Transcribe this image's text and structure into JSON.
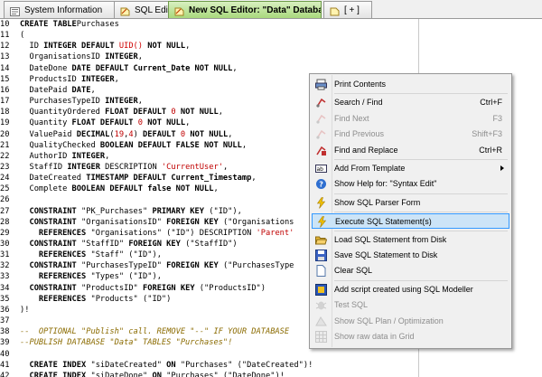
{
  "tabs": [
    {
      "label": "System Information",
      "icon": "info-icon"
    },
    {
      "label": "SQL Editor",
      "icon": "sql-editor-icon"
    },
    {
      "label": "New SQL Editor: \"Data\" Database",
      "icon": "sql-editor-icon"
    },
    {
      "label": "[ + ]",
      "icon": "new-tab-icon"
    }
  ],
  "code_lines": [
    {
      "n": "10",
      "segs": [
        [
          "kw",
          "CREATE TABLE"
        ],
        [
          "",
          "Purchases"
        ]
      ]
    },
    {
      "n": "11",
      "segs": [
        [
          "",
          "("
        ]
      ]
    },
    {
      "n": "12",
      "segs": [
        [
          "",
          "  ID "
        ],
        [
          "kw",
          "INTEGER DEFAULT"
        ],
        [
          "fn",
          " UID()"
        ],
        [
          "kw",
          " NOT NULL"
        ],
        [
          "",
          ","
        ]
      ]
    },
    {
      "n": "13",
      "segs": [
        [
          "",
          "  OrganisationsID "
        ],
        [
          "kw",
          "INTEGER"
        ],
        [
          "",
          ","
        ]
      ]
    },
    {
      "n": "14",
      "segs": [
        [
          "",
          "  DateDone "
        ],
        [
          "kw",
          "DATE DEFAULT"
        ],
        [
          "",
          " "
        ],
        [
          "kw",
          "Current_Date NOT NULL"
        ],
        [
          "",
          ","
        ]
      ]
    },
    {
      "n": "15",
      "segs": [
        [
          "",
          "  ProductsID "
        ],
        [
          "kw",
          "INTEGER"
        ],
        [
          "",
          ","
        ]
      ]
    },
    {
      "n": "16",
      "segs": [
        [
          "",
          "  DatePaid "
        ],
        [
          "kw",
          "DATE"
        ],
        [
          "",
          ","
        ]
      ]
    },
    {
      "n": "17",
      "segs": [
        [
          "",
          "  PurchasesTypeID "
        ],
        [
          "kw",
          "INTEGER"
        ],
        [
          "",
          ","
        ]
      ]
    },
    {
      "n": "18",
      "segs": [
        [
          "",
          "  QuantityOrdered "
        ],
        [
          "kw",
          "FLOAT DEFAULT"
        ],
        [
          "num",
          " 0"
        ],
        [
          "kw",
          " NOT NULL"
        ],
        [
          "",
          ","
        ]
      ]
    },
    {
      "n": "19",
      "segs": [
        [
          "",
          "  Quantity "
        ],
        [
          "kw",
          "FLOAT DEFAULT"
        ],
        [
          "num",
          " 0"
        ],
        [
          "kw",
          " NOT NULL"
        ],
        [
          "",
          ","
        ]
      ]
    },
    {
      "n": "20",
      "segs": [
        [
          "",
          "  ValuePaid "
        ],
        [
          "kw",
          "DECIMAL"
        ],
        [
          "",
          "("
        ],
        [
          "num",
          "19"
        ],
        [
          "",
          ","
        ],
        [
          "num",
          "4"
        ],
        [
          "",
          ") "
        ],
        [
          "kw",
          "DEFAULT"
        ],
        [
          "num",
          " 0"
        ],
        [
          "kw",
          " NOT NULL"
        ],
        [
          "",
          ","
        ]
      ]
    },
    {
      "n": "21",
      "segs": [
        [
          "",
          "  QualityChecked "
        ],
        [
          "kw",
          "BOOLEAN DEFAULT FALSE NOT NULL"
        ],
        [
          "",
          ","
        ]
      ]
    },
    {
      "n": "22",
      "segs": [
        [
          "",
          "  AuthorID "
        ],
        [
          "kw",
          "INTEGER"
        ],
        [
          "",
          ","
        ]
      ]
    },
    {
      "n": "23",
      "segs": [
        [
          "",
          "  StaffID "
        ],
        [
          "kw",
          "INTEGER"
        ],
        [
          "",
          " DESCRIPTION "
        ],
        [
          "str",
          "'CurrentUser'"
        ],
        [
          "",
          ","
        ]
      ]
    },
    {
      "n": "24",
      "segs": [
        [
          "",
          "  DateCreated "
        ],
        [
          "kw",
          "TIMESTAMP DEFAULT"
        ],
        [
          "",
          " "
        ],
        [
          "kw",
          "Current_Timestamp"
        ],
        [
          "",
          ","
        ]
      ]
    },
    {
      "n": "25",
      "segs": [
        [
          "",
          "  Complete "
        ],
        [
          "kw",
          "BOOLEAN DEFAULT"
        ],
        [
          "",
          " "
        ],
        [
          "kw",
          "false NOT NULL"
        ],
        [
          "",
          ","
        ]
      ]
    },
    {
      "n": "26",
      "segs": []
    },
    {
      "n": "27",
      "segs": [
        [
          "",
          "  "
        ],
        [
          "kw",
          "CONSTRAINT"
        ],
        [
          "",
          " \"PK_Purchases\" "
        ],
        [
          "kw",
          "PRIMARY KEY"
        ],
        [
          "",
          " (\"ID\"),"
        ]
      ]
    },
    {
      "n": "28",
      "segs": [
        [
          "",
          "  "
        ],
        [
          "kw",
          "CONSTRAINT"
        ],
        [
          "",
          " \"OrganisationsID\" "
        ],
        [
          "kw",
          "FOREIGN KEY"
        ],
        [
          "",
          " (\"Organisations"
        ]
      ]
    },
    {
      "n": "29",
      "segs": [
        [
          "",
          "    "
        ],
        [
          "kw",
          "REFERENCES"
        ],
        [
          "",
          " \"Organisations\" (\"ID\") DESCRIPTION "
        ],
        [
          "str",
          "'Parent'"
        ]
      ]
    },
    {
      "n": "30",
      "segs": [
        [
          "",
          "  "
        ],
        [
          "kw",
          "CONSTRAINT"
        ],
        [
          "",
          " \"StaffID\" "
        ],
        [
          "kw",
          "FOREIGN KEY"
        ],
        [
          "",
          " (\"StaffID\")"
        ]
      ]
    },
    {
      "n": "31",
      "segs": [
        [
          "",
          "    "
        ],
        [
          "kw",
          "REFERENCES"
        ],
        [
          "",
          " \"Staff\" (\"ID\"),"
        ]
      ]
    },
    {
      "n": "32",
      "segs": [
        [
          "",
          "  "
        ],
        [
          "kw",
          "CONSTRAINT"
        ],
        [
          "",
          " \"PurchasesTypeID\" "
        ],
        [
          "kw",
          "FOREIGN KEY"
        ],
        [
          "",
          " (\"PurchasesType"
        ]
      ]
    },
    {
      "n": "33",
      "segs": [
        [
          "",
          "    "
        ],
        [
          "kw",
          "REFERENCES"
        ],
        [
          "",
          " \"Types\" (\"ID\"),"
        ]
      ]
    },
    {
      "n": "34",
      "segs": [
        [
          "",
          "  "
        ],
        [
          "kw",
          "CONSTRAINT"
        ],
        [
          "",
          " \"ProductsID\" "
        ],
        [
          "kw",
          "FOREIGN KEY"
        ],
        [
          "",
          " (\"ProductsID\")"
        ]
      ]
    },
    {
      "n": "35",
      "segs": [
        [
          "",
          "    "
        ],
        [
          "kw",
          "REFERENCES"
        ],
        [
          "",
          " \"Products\" (\"ID\")"
        ]
      ]
    },
    {
      "n": "36",
      "segs": [
        [
          "",
          ")!"
        ]
      ]
    },
    {
      "n": "37",
      "segs": []
    },
    {
      "n": "38",
      "segs": [
        [
          "cm",
          "--  OPTIONAL \"Publish\" call. REMOVE \"--\" IF YOUR DATABASE"
        ]
      ]
    },
    {
      "n": "39",
      "segs": [
        [
          "cm",
          "--PUBLISH DATABASE \"Data\" TABLES \"Purchases\"!"
        ]
      ]
    },
    {
      "n": "40",
      "segs": []
    },
    {
      "n": "41",
      "segs": [
        [
          "",
          "  "
        ],
        [
          "kw",
          "CREATE INDEX"
        ],
        [
          "",
          " \"siDateCreated\" "
        ],
        [
          "kw",
          "ON"
        ],
        [
          "",
          " \"Purchases\" (\"DateCreated\")!"
        ]
      ]
    },
    {
      "n": "42",
      "segs": [
        [
          "",
          "  "
        ],
        [
          "kw",
          "CREATE INDEX"
        ],
        [
          "",
          " \"siDateDone\" "
        ],
        [
          "kw",
          "ON"
        ],
        [
          "",
          " \"Purchases\" (\"DateDone\")!"
        ]
      ]
    }
  ],
  "context_menu": {
    "items": [
      {
        "label": "Print Contents",
        "shortcut": "",
        "icon": "printer-icon",
        "enabled": true
      },
      {
        "sep": true
      },
      {
        "label": "Search / Find",
        "shortcut": "Ctrl+F",
        "icon": "search-icon",
        "enabled": true
      },
      {
        "label": "Find Next",
        "shortcut": "F3",
        "icon": "find-next-icon",
        "enabled": false
      },
      {
        "label": "Find Previous",
        "shortcut": "Shift+F3",
        "icon": "find-previous-icon",
        "enabled": false
      },
      {
        "label": "Find and Replace",
        "shortcut": "Ctrl+R",
        "icon": "replace-icon",
        "enabled": true
      },
      {
        "sep": true
      },
      {
        "label": "Add From Template",
        "shortcut": "",
        "icon": "template-icon",
        "enabled": true,
        "submenu": true
      },
      {
        "label": "Show Help for: \"Syntax Edit\"",
        "shortcut": "",
        "icon": "help-icon",
        "enabled": true
      },
      {
        "sep": true
      },
      {
        "label": "Show SQL Parser Form",
        "shortcut": "",
        "icon": "lightning-icon",
        "enabled": true
      },
      {
        "sep": true
      },
      {
        "label": "Execute SQL Statement(s)",
        "shortcut": "",
        "icon": "lightning-icon",
        "enabled": true,
        "highlighted": true
      },
      {
        "sep": true
      },
      {
        "label": "Load SQL Statement from Disk",
        "shortcut": "",
        "icon": "folder-open-icon",
        "enabled": true
      },
      {
        "label": "Save SQL Statement to Disk",
        "shortcut": "",
        "icon": "save-disk-icon",
        "enabled": true
      },
      {
        "label": "Clear SQL",
        "shortcut": "",
        "icon": "blank-document-icon",
        "enabled": true
      },
      {
        "sep": true
      },
      {
        "label": "Add script created using SQL Modeller",
        "shortcut": "",
        "icon": "modeller-icon",
        "enabled": true
      },
      {
        "label": "Test SQL",
        "shortcut": "",
        "icon": "bug-icon",
        "enabled": false
      },
      {
        "label": "Show SQL Plan / Optimization",
        "shortcut": "",
        "icon": "plan-icon",
        "enabled": false
      },
      {
        "label": "Show raw data in Grid",
        "shortcut": "",
        "icon": "grid-icon",
        "enabled": false
      }
    ]
  },
  "colors": {
    "active_tab": "#a8d87c",
    "menu_highlight": "#cce4f7",
    "menu_highlight_border": "#3399ff",
    "string_literal": "#c00000",
    "comment": "#8b6b00"
  }
}
